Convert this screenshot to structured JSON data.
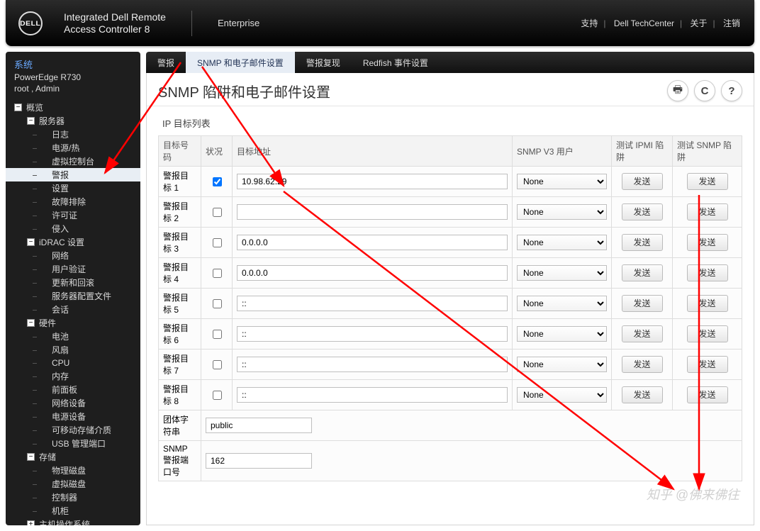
{
  "header": {
    "logo_text": "DELL",
    "product_line1": "Integrated Dell Remote",
    "product_line2": "Access Controller 8",
    "edition": "Enterprise",
    "links": {
      "support": "支持",
      "techcenter": "Dell TechCenter",
      "about": "关于",
      "logout": "注销"
    }
  },
  "sidebar": {
    "system_label": "系统",
    "model": "PowerEdge R730",
    "user_line": "root , Admin",
    "tree": [
      {
        "label": "概览",
        "lvl": 0,
        "expand": "−"
      },
      {
        "label": "服务器",
        "lvl": 1,
        "expand": "−"
      },
      {
        "label": "日志",
        "lvl": 2
      },
      {
        "label": "电源/热",
        "lvl": 2
      },
      {
        "label": "虚拟控制台",
        "lvl": 2
      },
      {
        "label": "警报",
        "lvl": 2,
        "active": true
      },
      {
        "label": "设置",
        "lvl": 2
      },
      {
        "label": "故障排除",
        "lvl": 2
      },
      {
        "label": "许可证",
        "lvl": 2
      },
      {
        "label": "侵入",
        "lvl": 2
      },
      {
        "label": "iDRAC 设置",
        "lvl": 1,
        "expand": "−"
      },
      {
        "label": "网络",
        "lvl": 2
      },
      {
        "label": "用户验证",
        "lvl": 2
      },
      {
        "label": "更新和回滚",
        "lvl": 2
      },
      {
        "label": "服务器配置文件",
        "lvl": 2
      },
      {
        "label": "会话",
        "lvl": 2
      },
      {
        "label": "硬件",
        "lvl": 1,
        "expand": "−"
      },
      {
        "label": "电池",
        "lvl": 2
      },
      {
        "label": "风扇",
        "lvl": 2
      },
      {
        "label": "CPU",
        "lvl": 2
      },
      {
        "label": "内存",
        "lvl": 2
      },
      {
        "label": "前面板",
        "lvl": 2
      },
      {
        "label": "网络设备",
        "lvl": 2
      },
      {
        "label": "电源设备",
        "lvl": 2
      },
      {
        "label": "可移动存储介质",
        "lvl": 2
      },
      {
        "label": "USB 管理端口",
        "lvl": 2
      },
      {
        "label": "存储",
        "lvl": 1,
        "expand": "−"
      },
      {
        "label": "物理磁盘",
        "lvl": 2
      },
      {
        "label": "虚拟磁盘",
        "lvl": 2
      },
      {
        "label": "控制器",
        "lvl": 2
      },
      {
        "label": "机柜",
        "lvl": 2
      },
      {
        "label": "主机操作系统",
        "lvl": 1,
        "expand": "+"
      }
    ]
  },
  "tabs": {
    "items": [
      {
        "label": "警报",
        "active": false
      },
      {
        "label": "SNMP 和电子邮件设置",
        "active": true
      },
      {
        "label": "警报复现",
        "active": false
      },
      {
        "label": "Redfish 事件设置",
        "active": false
      }
    ]
  },
  "page": {
    "title": "SNMP 陷阱和电子邮件设置",
    "section_title": "IP 目标列表",
    "columns": {
      "num": "目标号码",
      "status": "状况",
      "addr": "目标地址",
      "user": "SNMP V3 用户",
      "test_ipmi": "测试 IPMI 陷阱",
      "test_snmp": "测试 SNMP 陷阱"
    },
    "rows": [
      {
        "name": "警报目标 1",
        "checked": true,
        "addr": "10.98.62.29",
        "user": "None"
      },
      {
        "name": "警报目标 2",
        "checked": false,
        "addr": "",
        "user": "None"
      },
      {
        "name": "警报目标 3",
        "checked": false,
        "addr": "0.0.0.0",
        "user": "None"
      },
      {
        "name": "警报目标 4",
        "checked": false,
        "addr": "0.0.0.0",
        "user": "None"
      },
      {
        "name": "警报目标 5",
        "checked": false,
        "addr": "::",
        "user": "None"
      },
      {
        "name": "警报目标 6",
        "checked": false,
        "addr": "::",
        "user": "None"
      },
      {
        "name": "警报目标 7",
        "checked": false,
        "addr": "::",
        "user": "None"
      },
      {
        "name": "警报目标 8",
        "checked": false,
        "addr": "::",
        "user": "None"
      }
    ],
    "community_label": "团体字符串",
    "community_value": "public",
    "port_label": "SNMP 警报端口号",
    "port_value": "162",
    "send_label": "发送"
  },
  "watermark": "知乎 @佛来佛往"
}
